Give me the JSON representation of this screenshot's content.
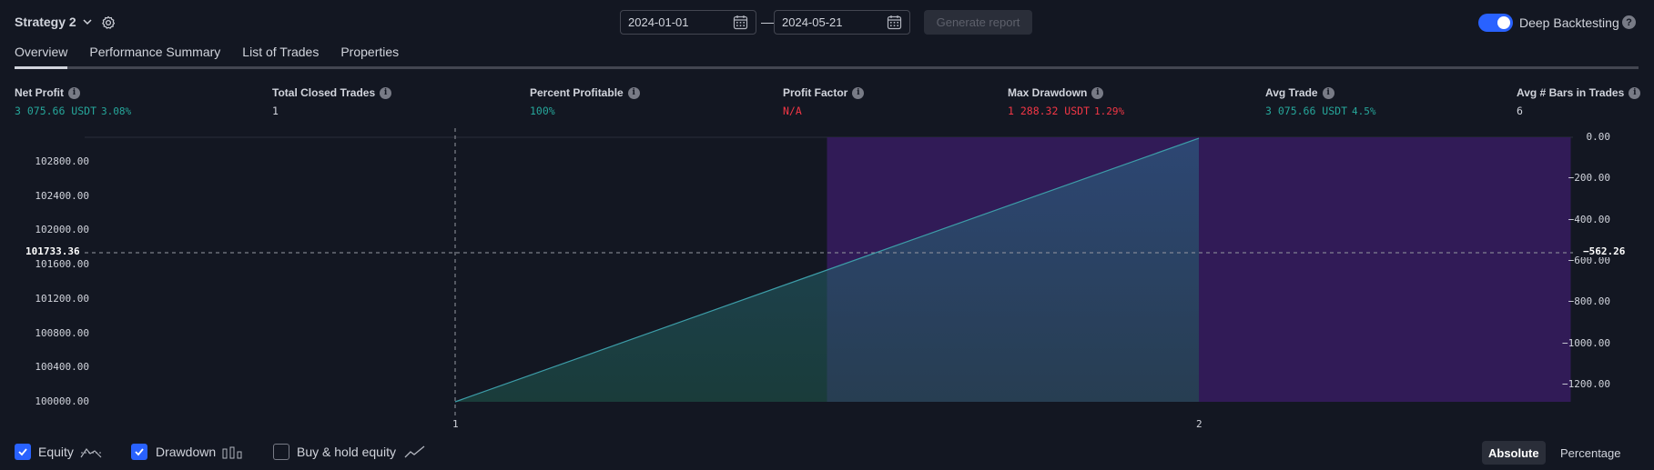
{
  "header": {
    "strategy_name": "Strategy 2",
    "date_from": "2024-01-01",
    "date_to": "2024-05-21",
    "date_separator": "—",
    "generate_label": "Generate report",
    "deep_backtesting_label": "Deep Backtesting",
    "deep_backtesting_enabled": true,
    "help_glyph": "?"
  },
  "tabs": [
    {
      "label": "Overview",
      "active": true
    },
    {
      "label": "Performance Summary",
      "active": false
    },
    {
      "label": "List of Trades",
      "active": false
    },
    {
      "label": "Properties",
      "active": false
    }
  ],
  "stats": [
    {
      "label": "Net Profit",
      "value": "3 075.66 USDT",
      "pct": "3.08%",
      "color": "#26a69a"
    },
    {
      "label": "Total Closed Trades",
      "value": "1",
      "pct": "",
      "color": "#d1d4dc"
    },
    {
      "label": "Percent Profitable",
      "value": "100%",
      "pct": "",
      "color": "#26a69a"
    },
    {
      "label": "Profit Factor",
      "value": "N/A",
      "pct": "",
      "color": "#f23645"
    },
    {
      "label": "Max Drawdown",
      "value": "1 288.32 USDT",
      "pct": "1.29%",
      "color": "#f23645"
    },
    {
      "label": "Avg Trade",
      "value": "3 075.66 USDT",
      "pct": "4.5%",
      "color": "#26a69a"
    },
    {
      "label": "Avg # Bars in Trades",
      "value": "6",
      "pct": "",
      "color": "#d1d4dc"
    }
  ],
  "chart_data": {
    "type": "area",
    "x_ticks": [
      "1",
      "2"
    ],
    "left_axis": {
      "ticks": [
        "102800.00",
        "102400.00",
        "102000.00",
        "101600.00",
        "101200.00",
        "100800.00",
        "100400.00",
        "100000.00"
      ],
      "tick_values": [
        102800,
        102400,
        102000,
        101600,
        101200,
        100800,
        100400,
        100000
      ]
    },
    "right_axis": {
      "ticks": [
        "0.00",
        "−200.00",
        "−400.00",
        "−600.00",
        "−800.00",
        "−1000.00",
        "−1200.00"
      ],
      "tick_values": [
        0,
        -200,
        -400,
        -600,
        -800,
        -1000,
        -1200
      ]
    },
    "series": [
      {
        "name": "Equity",
        "x": [
          1,
          2
        ],
        "values": [
          100000,
          103075.66
        ],
        "color": "#26a69a"
      },
      {
        "name": "Drawdown",
        "segments": [
          [
            1.5,
            2
          ],
          [
            2,
            2.5
          ]
        ],
        "values": [
          -1288.32,
          -1288.32
        ],
        "color": "#311b57"
      }
    ],
    "crosshair": {
      "x": 1,
      "left_label": "101733.36",
      "right_label": "−562.26"
    }
  },
  "legend": {
    "equity": {
      "label": "Equity",
      "checked": true
    },
    "drawdown": {
      "label": "Drawdown",
      "checked": true
    },
    "buyhold": {
      "label": "Buy & hold equity",
      "checked": false
    }
  },
  "modes": {
    "absolute": "Absolute",
    "percentage": "Percentage",
    "active": "absolute"
  }
}
